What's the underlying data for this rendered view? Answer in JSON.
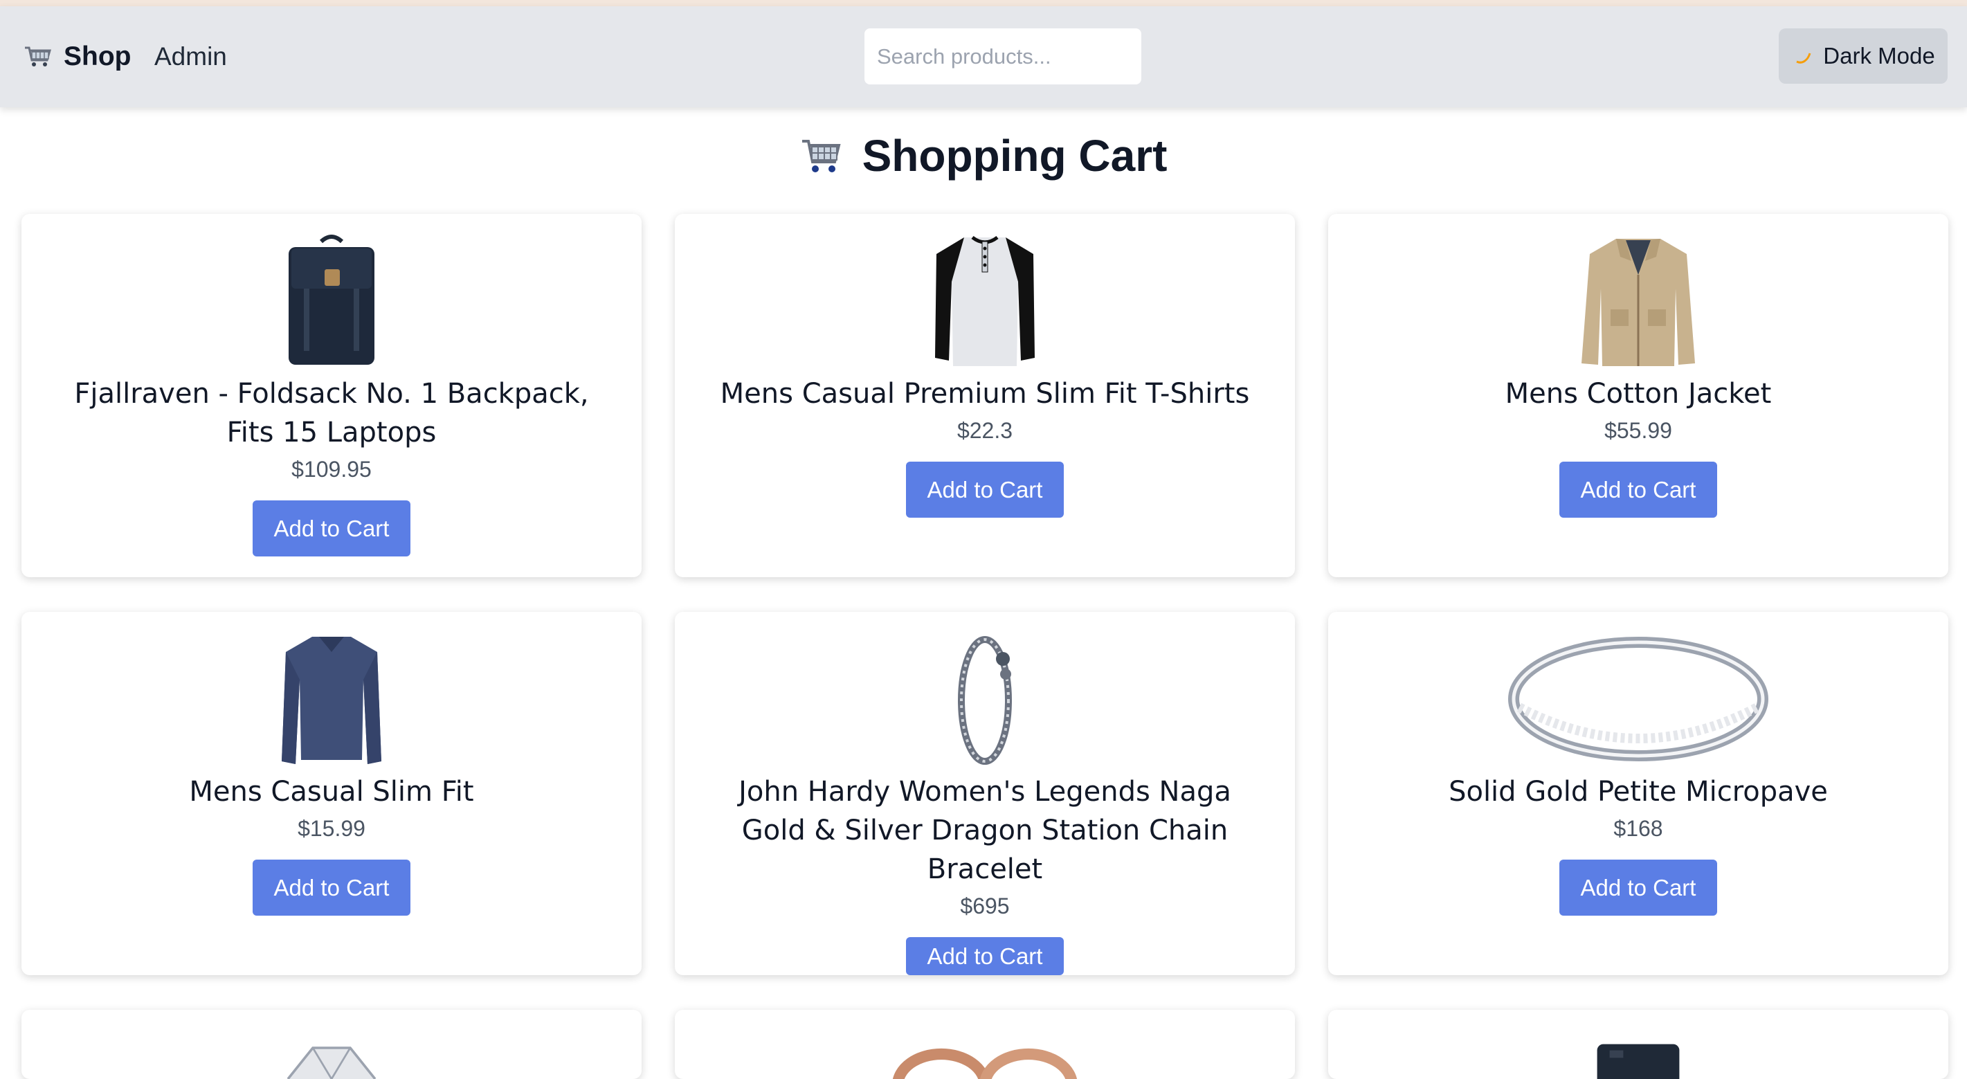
{
  "nav": {
    "brand": "Shop",
    "admin": "Admin",
    "search_placeholder": "Search products...",
    "dark_mode": "Dark Mode"
  },
  "title": "Shopping Cart",
  "products": [
    {
      "name": "Fjallraven - Foldsack No. 1 Backpack, Fits 15 Laptops",
      "price": "$109.95",
      "button": "Add to Cart",
      "image": "backpack"
    },
    {
      "name": "Mens Casual Premium Slim Fit T-Shirts",
      "price": "$22.3",
      "button": "Add to Cart",
      "image": "t-shirt"
    },
    {
      "name": "Mens Cotton Jacket",
      "price": "$55.99",
      "button": "Add to Cart",
      "image": "jacket"
    },
    {
      "name": "Mens Casual Slim Fit",
      "price": "$15.99",
      "button": "Add to Cart",
      "image": "long-sleeve-shirt"
    },
    {
      "name": "John Hardy Women's Legends Naga Gold & Silver Dragon Station Chain Bracelet",
      "price": "$695",
      "button": "Add to Cart",
      "image": "bracelet"
    },
    {
      "name": "Solid Gold Petite Micropave",
      "price": "$168",
      "button": "Add to Cart",
      "image": "ring"
    }
  ],
  "partial_products": [
    {
      "image": "diamond-ring"
    },
    {
      "image": "rose-gold-rings"
    },
    {
      "image": "hard-drive"
    }
  ],
  "colors": {
    "accent": "#5b7ee5",
    "navbar": "#e5e7eb"
  }
}
